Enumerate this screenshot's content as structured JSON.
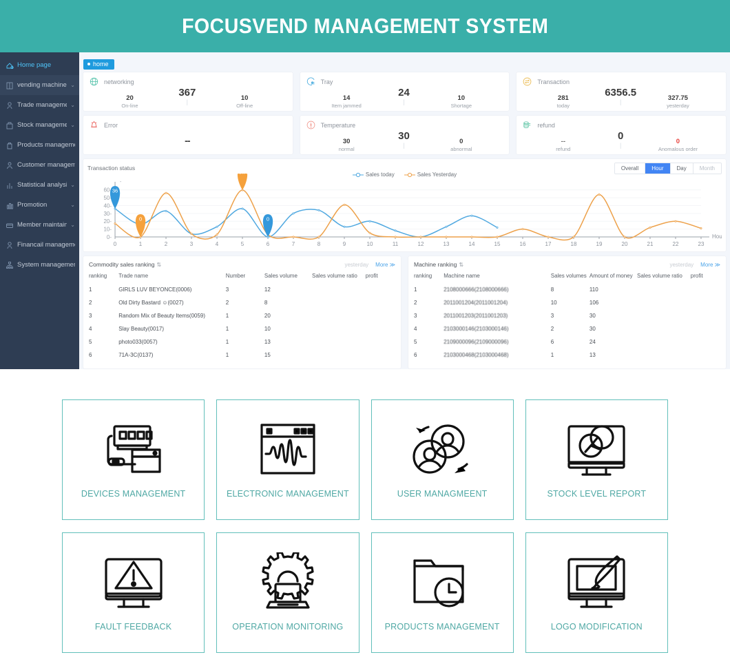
{
  "header": {
    "title": "FOCUSVEND MANAGEMENT SYSTEM",
    "bg": "#3aafa9"
  },
  "sidebar": {
    "items": [
      {
        "label": "Home page",
        "icon": "home-icon",
        "active": true,
        "caret": ""
      },
      {
        "label": "vending machine",
        "icon": "machine-icon",
        "active": false,
        "caret": "⌄"
      },
      {
        "label": "Trade management",
        "icon": "trade-icon",
        "active": false,
        "caret": "⌄"
      },
      {
        "label": "Stock management",
        "icon": "stock-icon",
        "active": false,
        "caret": "⌄"
      },
      {
        "label": "Products management",
        "icon": "products-icon",
        "active": false,
        "caret": ""
      },
      {
        "label": "Customer management",
        "icon": "customer-icon",
        "active": false,
        "caret": ""
      },
      {
        "label": "Statistical analysis",
        "icon": "stats-icon",
        "active": false,
        "caret": "⌄"
      },
      {
        "label": "Promotion",
        "icon": "promotion-icon",
        "active": false,
        "caret": "⌄"
      },
      {
        "label": "Member maintain",
        "icon": "member-icon",
        "active": false,
        "caret": "⌄"
      },
      {
        "label": "Financail management",
        "icon": "finance-icon",
        "active": false,
        "caret": ""
      },
      {
        "label": "System management",
        "icon": "system-icon",
        "active": false,
        "caret": ""
      }
    ]
  },
  "tabs": {
    "home": "home"
  },
  "cards": [
    {
      "name": "networking",
      "icon": "globe-icon",
      "main": "367",
      "left_v": "20",
      "left_l": "On-line",
      "right_v": "10",
      "right_l": "Off-line"
    },
    {
      "name": "Tray",
      "icon": "tray-icon",
      "main": "24",
      "left_v": "14",
      "left_l": "Item jammed",
      "right_v": "10",
      "right_l": "Shortage"
    },
    {
      "name": "Transaction",
      "icon": "swap-icon",
      "main": "6356.5",
      "left_v": "281",
      "left_l": "today",
      "right_v": "327.75",
      "right_l": "yesterday"
    },
    {
      "name": "Error",
      "icon": "alarm-icon",
      "main": "--",
      "left_v": "",
      "left_l": "",
      "right_v": "",
      "right_l": ""
    },
    {
      "name": "Temperature",
      "icon": "temp-icon",
      "main": "30",
      "left_v": "30",
      "left_l": "normal",
      "right_v": "0",
      "right_l": "abnormal"
    },
    {
      "name": "refund",
      "icon": "coins-icon",
      "main": "0",
      "left_v": "--",
      "left_l": "refund",
      "right_v": "0",
      "right_l": "Anomalous order",
      "right_danger": true
    }
  ],
  "chart_panel": {
    "title": "Transaction status",
    "range_buttons": [
      {
        "label": "Overall",
        "active": false,
        "disabled": false
      },
      {
        "label": "Hour",
        "active": true,
        "disabled": false
      },
      {
        "label": "Day",
        "active": false,
        "disabled": false
      },
      {
        "label": "Month",
        "active": false,
        "disabled": true
      }
    ]
  },
  "chart_data": {
    "type": "line",
    "title": "Transaction status",
    "xlabel": "Hou",
    "ylabel": "",
    "grid": true,
    "legend_position": "top-center",
    "xlim": [
      0,
      23
    ],
    "ylim": [
      0,
      65
    ],
    "yticks": [
      0,
      10,
      20,
      30,
      40,
      50,
      60
    ],
    "categories": [
      "0",
      "1",
      "2",
      "3",
      "4",
      "5",
      "6",
      "7",
      "8",
      "9",
      "10",
      "11",
      "12",
      "13",
      "14",
      "15",
      "16",
      "17",
      "18",
      "19",
      "20",
      "21",
      "22",
      "23"
    ],
    "series": [
      {
        "name": "Sales today",
        "color": "#4fa8e0",
        "values": [
          36,
          16,
          33,
          4,
          13,
          36,
          0,
          30,
          34,
          13,
          20,
          8,
          0,
          13,
          27,
          12,
          null,
          null,
          null,
          null,
          null,
          null,
          null,
          null
        ]
      },
      {
        "name": "Sales Yesterday",
        "color": "#eda14a",
        "values": [
          17,
          0,
          56,
          4,
          3,
          59.75,
          3,
          0,
          0,
          41,
          5,
          0,
          0,
          0,
          0,
          0,
          10,
          0,
          0,
          54,
          0,
          12,
          20,
          11
        ]
      }
    ],
    "annotations": [
      {
        "series": "Sales today",
        "x": "0",
        "value": "36",
        "color": "#3498db"
      },
      {
        "series": "Sales Yesterday",
        "x": "1",
        "value": "0",
        "color": "#f5a13c"
      },
      {
        "series": "Sales Yesterday",
        "x": "5",
        "value": "59.75",
        "color": "#f5a13c"
      },
      {
        "series": "Sales today",
        "x": "6",
        "value": "0",
        "color": "#3498db"
      }
    ]
  },
  "commodity_ranking": {
    "title": "Commodity sales ranking",
    "sort_icon": "sort-icon",
    "period": "yesterday",
    "more": "More ≫",
    "columns": [
      "ranking",
      "Trade name",
      "Number",
      "Sales volume",
      "Sales volume ratio",
      "profit"
    ],
    "rows": [
      [
        "1",
        "GIRLS LUV BEYONCE(0006)",
        "3",
        "12",
        "",
        ""
      ],
      [
        "2",
        "Old Dirty Bastard ☺(0027)",
        "2",
        "8",
        "",
        ""
      ],
      [
        "3",
        "Random Mix of Beauty Items(0059)",
        "1",
        "20",
        "",
        ""
      ],
      [
        "4",
        "Slay Beauty(0017)",
        "1",
        "10",
        "",
        ""
      ],
      [
        "5",
        "photo033(0057)",
        "1",
        "13",
        "",
        ""
      ],
      [
        "6",
        "71A-3C(0137)",
        "1",
        "15",
        "",
        ""
      ]
    ]
  },
  "machine_ranking": {
    "title": "Machine ranking",
    "sort_icon": "sort-icon",
    "period": "yesterday",
    "more": "More ≫",
    "columns": [
      "ranking",
      "Machine name",
      "Sales volumes",
      "Amount of money",
      "Sales volume ratio",
      "profit"
    ],
    "rows": [
      [
        "1",
        "2108000666(2108000666)",
        "8",
        "110",
        "",
        ""
      ],
      [
        "2",
        "2011001204(2011001204)",
        "10",
        "106",
        "",
        ""
      ],
      [
        "3",
        "2011001203(2011001203)",
        "3",
        "30",
        "",
        ""
      ],
      [
        "4",
        "2103000146(2103000146)",
        "2",
        "30",
        "",
        ""
      ],
      [
        "5",
        "2109000096(2109000096)",
        "6",
        "24",
        "",
        ""
      ],
      [
        "6",
        "2103000468(2103000468)",
        "1",
        "13",
        "",
        ""
      ]
    ]
  },
  "quick_links": [
    {
      "label": "DEVICES MANAGEMENT",
      "icon": "vending-device-icon"
    },
    {
      "label": "ELECTRONIC MANAGEMENT",
      "icon": "waveform-window-icon"
    },
    {
      "label": "USER MANAGMEENT",
      "icon": "users-cycle-icon"
    },
    {
      "label": "STOCK LEVEL REPORT",
      "icon": "monitor-pie-icon"
    },
    {
      "label": "FAULT FEEDBACK",
      "icon": "monitor-warning-icon"
    },
    {
      "label": "OPERATION MONITORING",
      "icon": "gear-laptop-icon"
    },
    {
      "label": "PRODUCTS MANAGEMENT",
      "icon": "folder-clock-icon"
    },
    {
      "label": "LOGO MODIFICATION",
      "icon": "monitor-brush-icon"
    }
  ],
  "colors": {
    "accent_teal": "#3aafa9",
    "card_border": "#61bfba",
    "sidebar": "#2e3d53",
    "active_blue": "#4285f4"
  }
}
